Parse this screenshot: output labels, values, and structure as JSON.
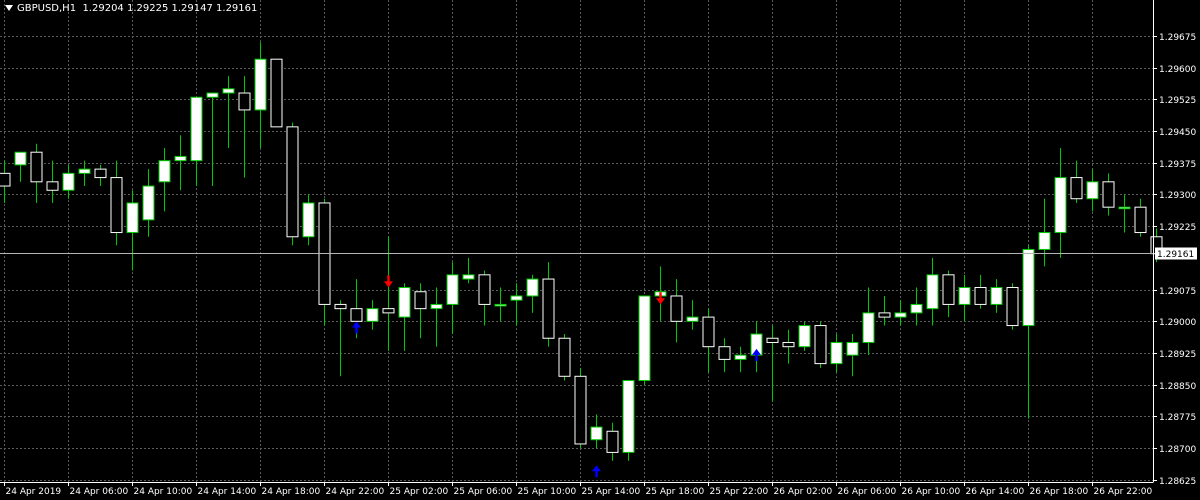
{
  "window": {
    "symbol_label": "GBPUSD,H1",
    "ohlc_label": "1.29204 1.29225 1.29147 1.29161"
  },
  "colors": {
    "background": "#000000",
    "grid": "#5a5a5a",
    "axis": "#ffffff",
    "wick": "#00c800",
    "candle_body": "#ffffff",
    "bid_line": "#b4b4b4",
    "signal_sell": "#ff0000",
    "signal_buy": "#0000ff"
  },
  "chart_data": {
    "type": "candlestick",
    "timeframe": "H1",
    "ylim": [
      1.2862,
      1.2976
    ],
    "y_ticks": [
      1.29675,
      1.296,
      1.29525,
      1.2945,
      1.29375,
      1.293,
      1.29225,
      1.29075,
      1.29,
      1.28925,
      1.2885,
      1.28775,
      1.287,
      1.28625
    ],
    "y_tick_labels": [
      "1.29675",
      "1.29600",
      "1.29525",
      "1.29450",
      "1.29375",
      "1.29300",
      "1.29225",
      "1.29075",
      "1.29000",
      "1.28925",
      "1.28850",
      "1.28775",
      "1.28700",
      "1.28625"
    ],
    "x_labels": [
      {
        "i": 0,
        "label": "24 Apr 2019"
      },
      {
        "i": 4,
        "label": "24 Apr 06:00"
      },
      {
        "i": 8,
        "label": "24 Apr 10:00"
      },
      {
        "i": 12,
        "label": "24 Apr 14:00"
      },
      {
        "i": 16,
        "label": "24 Apr 18:00"
      },
      {
        "i": 20,
        "label": "24 Apr 22:00"
      },
      {
        "i": 24,
        "label": "25 Apr 02:00"
      },
      {
        "i": 28,
        "label": "25 Apr 06:00"
      },
      {
        "i": 32,
        "label": "25 Apr 10:00"
      },
      {
        "i": 36,
        "label": "25 Apr 14:00"
      },
      {
        "i": 40,
        "label": "25 Apr 18:00"
      },
      {
        "i": 44,
        "label": "25 Apr 22:00"
      },
      {
        "i": 48,
        "label": "26 Apr 02:00"
      },
      {
        "i": 52,
        "label": "26 Apr 06:00"
      },
      {
        "i": 56,
        "label": "26 Apr 10:00"
      },
      {
        "i": 60,
        "label": "26 Apr 14:00"
      },
      {
        "i": 64,
        "label": "26 Apr 18:00"
      },
      {
        "i": 68,
        "label": "26 Apr 22:00"
      }
    ],
    "current_price": 1.29161,
    "current_price_label": "1.29161",
    "candles": [
      {
        "o": 1.2935,
        "h": 1.2938,
        "l": 1.2928,
        "c": 1.2932
      },
      {
        "o": 1.2937,
        "h": 1.294,
        "l": 1.2933,
        "c": 1.294
      },
      {
        "o": 1.294,
        "h": 1.2942,
        "l": 1.2928,
        "c": 1.2933
      },
      {
        "o": 1.2933,
        "h": 1.2938,
        "l": 1.2928,
        "c": 1.2931
      },
      {
        "o": 1.2931,
        "h": 1.2937,
        "l": 1.2929,
        "c": 1.2935
      },
      {
        "o": 1.2935,
        "h": 1.2938,
        "l": 1.2932,
        "c": 1.2936
      },
      {
        "o": 1.2936,
        "h": 1.2937,
        "l": 1.2932,
        "c": 1.2934
      },
      {
        "o": 1.2934,
        "h": 1.2938,
        "l": 1.2918,
        "c": 1.2921
      },
      {
        "o": 1.2921,
        "h": 1.2931,
        "l": 1.2912,
        "c": 1.2928
      },
      {
        "o": 1.2924,
        "h": 1.2936,
        "l": 1.292,
        "c": 1.2932
      },
      {
        "o": 1.2933,
        "h": 1.2941,
        "l": 1.2926,
        "c": 1.2938
      },
      {
        "o": 1.2938,
        "h": 1.2944,
        "l": 1.2931,
        "c": 1.2939
      },
      {
        "o": 1.2938,
        "h": 1.2952,
        "l": 1.2932,
        "c": 1.2953
      },
      {
        "o": 1.2953,
        "h": 1.2954,
        "l": 1.2932,
        "c": 1.2954
      },
      {
        "o": 1.2954,
        "h": 1.2958,
        "l": 1.2941,
        "c": 1.2955
      },
      {
        "o": 1.2954,
        "h": 1.2958,
        "l": 1.2934,
        "c": 1.295
      },
      {
        "o": 1.295,
        "h": 1.2966,
        "l": 1.2941,
        "c": 1.2962
      },
      {
        "o": 1.2962,
        "h": 1.2962,
        "l": 1.2948,
        "c": 1.2946
      },
      {
        "o": 1.2946,
        "h": 1.2947,
        "l": 1.2918,
        "c": 1.292
      },
      {
        "o": 1.292,
        "h": 1.293,
        "l": 1.2918,
        "c": 1.2928
      },
      {
        "o": 1.2928,
        "h": 1.2929,
        "l": 1.2899,
        "c": 1.2904
      },
      {
        "o": 1.2904,
        "h": 1.2905,
        "l": 1.2887,
        "c": 1.2903
      },
      {
        "o": 1.2903,
        "h": 1.291,
        "l": 1.2896,
        "c": 1.29
      },
      {
        "o": 1.29,
        "h": 1.2905,
        "l": 1.2898,
        "c": 1.2903
      },
      {
        "o": 1.2903,
        "h": 1.292,
        "l": 1.2893,
        "c": 1.2902
      },
      {
        "o": 1.2901,
        "h": 1.2909,
        "l": 1.2893,
        "c": 1.2908
      },
      {
        "o": 1.2907,
        "h": 1.2909,
        "l": 1.2896,
        "c": 1.2903
      },
      {
        "o": 1.2903,
        "h": 1.2908,
        "l": 1.2894,
        "c": 1.2904
      },
      {
        "o": 1.2904,
        "h": 1.2914,
        "l": 1.2897,
        "c": 1.2911
      },
      {
        "o": 1.291,
        "h": 1.2915,
        "l": 1.2909,
        "c": 1.2911
      },
      {
        "o": 1.2911,
        "h": 1.2912,
        "l": 1.2899,
        "c": 1.2904
      },
      {
        "o": 1.2904,
        "h": 1.2908,
        "l": 1.29,
        "c": 1.2904
      },
      {
        "o": 1.2905,
        "h": 1.2909,
        "l": 1.2899,
        "c": 1.2906
      },
      {
        "o": 1.2906,
        "h": 1.2911,
        "l": 1.2902,
        "c": 1.291
      },
      {
        "o": 1.291,
        "h": 1.2914,
        "l": 1.2894,
        "c": 1.2896
      },
      {
        "o": 1.2896,
        "h": 1.2897,
        "l": 1.2886,
        "c": 1.2887
      },
      {
        "o": 1.2887,
        "h": 1.2889,
        "l": 1.287,
        "c": 1.2871
      },
      {
        "o": 1.2872,
        "h": 1.2878,
        "l": 1.287,
        "c": 1.2875
      },
      {
        "o": 1.2874,
        "h": 1.2876,
        "l": 1.2867,
        "c": 1.2869
      },
      {
        "o": 1.2869,
        "h": 1.2886,
        "l": 1.2867,
        "c": 1.2886
      },
      {
        "o": 1.2886,
        "h": 1.2906,
        "l": 1.2885,
        "c": 1.2906
      },
      {
        "o": 1.2906,
        "h": 1.2913,
        "l": 1.29,
        "c": 1.2907
      },
      {
        "o": 1.2906,
        "h": 1.291,
        "l": 1.2895,
        "c": 1.29
      },
      {
        "o": 1.29,
        "h": 1.2905,
        "l": 1.2898,
        "c": 1.2901
      },
      {
        "o": 1.2901,
        "h": 1.2903,
        "l": 1.2888,
        "c": 1.2894
      },
      {
        "o": 1.2894,
        "h": 1.2896,
        "l": 1.2888,
        "c": 1.2891
      },
      {
        "o": 1.2891,
        "h": 1.2894,
        "l": 1.2888,
        "c": 1.2892
      },
      {
        "o": 1.2892,
        "h": 1.29,
        "l": 1.2888,
        "c": 1.2897
      },
      {
        "o": 1.2896,
        "h": 1.2899,
        "l": 1.2881,
        "c": 1.2895
      },
      {
        "o": 1.2895,
        "h": 1.2898,
        "l": 1.289,
        "c": 1.2894
      },
      {
        "o": 1.2894,
        "h": 1.29,
        "l": 1.2893,
        "c": 1.2899
      },
      {
        "o": 1.2899,
        "h": 1.29,
        "l": 1.2889,
        "c": 1.289
      },
      {
        "o": 1.289,
        "h": 1.2897,
        "l": 1.2888,
        "c": 1.2895
      },
      {
        "o": 1.2892,
        "h": 1.2897,
        "l": 1.2887,
        "c": 1.2895
      },
      {
        "o": 1.2895,
        "h": 1.2908,
        "l": 1.2892,
        "c": 1.2902
      },
      {
        "o": 1.2902,
        "h": 1.2906,
        "l": 1.2899,
        "c": 1.2901
      },
      {
        "o": 1.2901,
        "h": 1.2905,
        "l": 1.2899,
        "c": 1.2902
      },
      {
        "o": 1.2902,
        "h": 1.2908,
        "l": 1.2899,
        "c": 1.2904
      },
      {
        "o": 1.2903,
        "h": 1.2915,
        "l": 1.2899,
        "c": 1.2911
      },
      {
        "o": 1.2911,
        "h": 1.2912,
        "l": 1.2901,
        "c": 1.2904
      },
      {
        "o": 1.2904,
        "h": 1.2911,
        "l": 1.29,
        "c": 1.2908
      },
      {
        "o": 1.2908,
        "h": 1.2911,
        "l": 1.2903,
        "c": 1.2904
      },
      {
        "o": 1.2904,
        "h": 1.291,
        "l": 1.2902,
        "c": 1.2908
      },
      {
        "o": 1.2908,
        "h": 1.2909,
        "l": 1.2898,
        "c": 1.2899
      },
      {
        "o": 1.2899,
        "h": 1.2918,
        "l": 1.2877,
        "c": 1.2917
      },
      {
        "o": 1.2917,
        "h": 1.2929,
        "l": 1.2913,
        "c": 1.2921
      },
      {
        "o": 1.2921,
        "h": 1.2941,
        "l": 1.2915,
        "c": 1.2934
      },
      {
        "o": 1.2934,
        "h": 1.2938,
        "l": 1.2928,
        "c": 1.2929
      },
      {
        "o": 1.2929,
        "h": 1.2936,
        "l": 1.2926,
        "c": 1.2933
      },
      {
        "o": 1.2933,
        "h": 1.2935,
        "l": 1.2925,
        "c": 1.2927
      },
      {
        "o": 1.2927,
        "h": 1.293,
        "l": 1.2921,
        "c": 1.2927
      },
      {
        "o": 1.2927,
        "h": 1.2929,
        "l": 1.292,
        "c": 1.2921
      },
      {
        "o": 1.292,
        "h": 1.2922,
        "l": 1.2914,
        "c": 1.2916
      }
    ],
    "signals": [
      {
        "i": 22,
        "type": "buy",
        "price": 1.28995
      },
      {
        "i": 24,
        "type": "sell",
        "price": 1.29085
      },
      {
        "i": 41,
        "type": "sell",
        "price": 1.29045
      },
      {
        "i": 47,
        "type": "buy",
        "price": 1.2893
      },
      {
        "i": 37,
        "type": "buy",
        "price": 1.28655
      }
    ]
  }
}
